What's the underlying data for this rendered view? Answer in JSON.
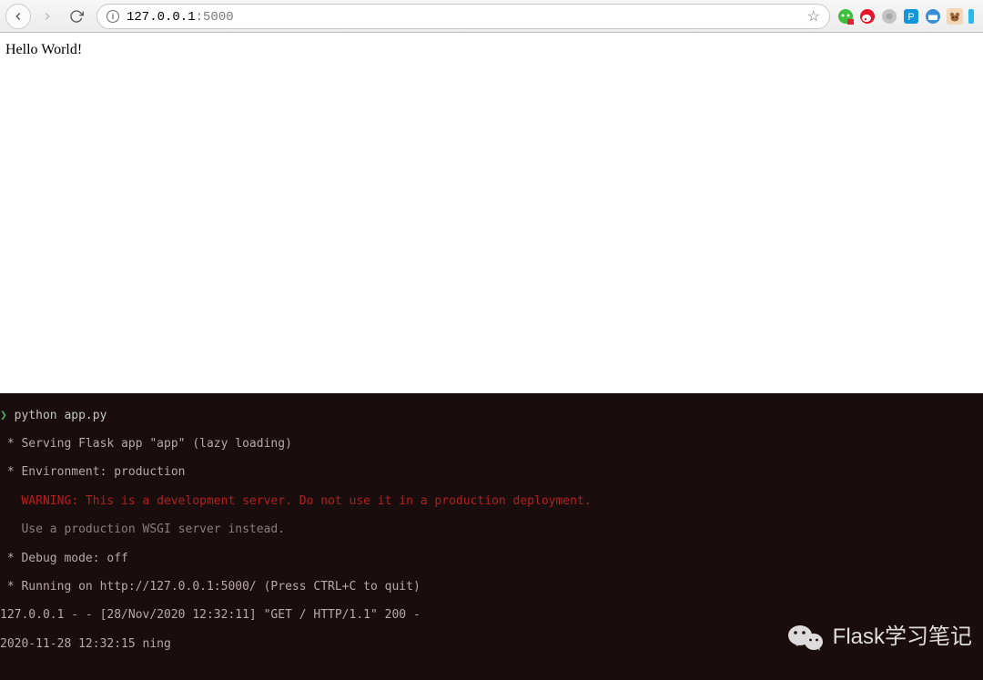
{
  "browser": {
    "url_host": "127.0.0.1",
    "url_port": ":5000"
  },
  "page": {
    "body_text": "Hello World!"
  },
  "terminal": {
    "prompt": "❯",
    "command": "python app.py",
    "lines": {
      "serving": " * Serving Flask app \"app\" (lazy loading)",
      "env": " * Environment: production",
      "warn": "   WARNING: This is a development server. Do not use it in a production deployment.",
      "use_prod": "   Use a production WSGI server instead.",
      "debug": " * Debug mode: off",
      "running": " * Running on http://127.0.0.1:5000/ (Press CTRL+C to quit)",
      "req": "127.0.0.1 - - [28/Nov/2020 12:32:11] \"GET / HTTP/1.1\" 200 -",
      "ts": "2020-11-28 12:32:15 ning"
    }
  },
  "watermark": {
    "text": "Flask学习笔记"
  }
}
